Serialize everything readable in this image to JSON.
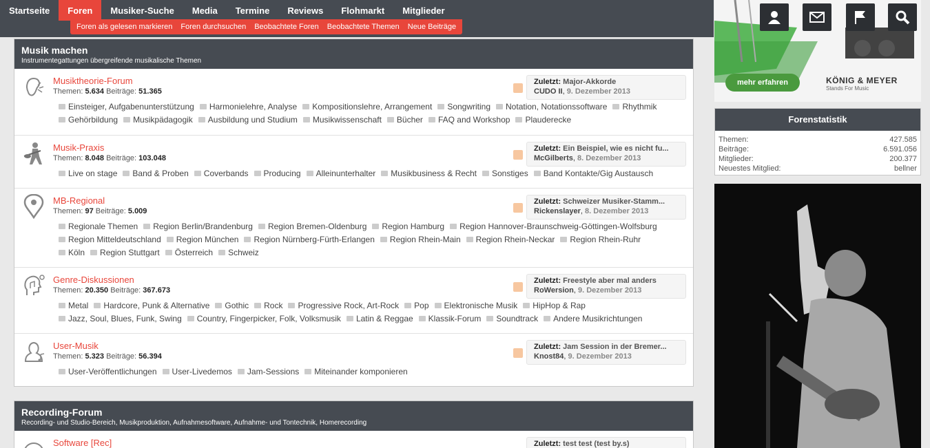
{
  "nav": {
    "items": [
      "Startseite",
      "Foren",
      "Musiker-Suche",
      "Media",
      "Termine",
      "Reviews",
      "Flohmarkt",
      "Mitglieder"
    ],
    "sub": [
      "Foren als gelesen markieren",
      "Foren durchsuchen",
      "Beobachtete Foren",
      "Beobachtete Themen",
      "Neue Beiträge"
    ]
  },
  "toolbar": {
    "icons": [
      "user-icon",
      "mail-icon",
      "flag-icon",
      "search-icon"
    ]
  },
  "sections": [
    {
      "title": "Musik machen",
      "subtitle": "Instrumentegattungen übergreifende musikalische Themen",
      "nodes": [
        {
          "title": "Musiktheorie-Forum",
          "themen_label": "Themen:",
          "themen": "5.634",
          "beitraege_label": "Beiträge:",
          "beitraege": "51.365",
          "subforums": [
            "Einsteiger, Aufgabenunterstützung",
            "Harmonielehre, Analyse",
            "Kompositionslehre, Arrangement",
            "Songwriting",
            "Notation, Notationssoftware",
            "Rhythmik",
            "Gehörbildung",
            "Musikpädagogik",
            "Ausbildung und Studium",
            "Musikwissenschaft",
            "Bücher",
            "FAQ and Workshop",
            "Plauderecke"
          ],
          "last_label": "Zuletzt:",
          "last_title": "Major-Akkorde",
          "last_user": "CUDO II",
          "last_date": "9. Dezember 2013"
        },
        {
          "title": "Musik-Praxis",
          "themen_label": "Themen:",
          "themen": "8.048",
          "beitraege_label": "Beiträge:",
          "beitraege": "103.048",
          "subforums": [
            "Live on stage",
            "Band & Proben",
            "Coverbands",
            "Producing",
            "Alleinunterhalter",
            "Musikbusiness & Recht",
            "Sonstiges",
            "Band Kontakte/Gig Austausch"
          ],
          "last_label": "Zuletzt:",
          "last_title": "Ein Beispiel, wie es nicht fu...",
          "last_user": "McGilberts",
          "last_date": "8. Dezember 2013"
        },
        {
          "title": "MB-Regional",
          "themen_label": "Themen:",
          "themen": "97",
          "beitraege_label": "Beiträge:",
          "beitraege": "5.009",
          "subforums": [
            "Regionale Themen",
            "Region Berlin/Brandenburg",
            "Region Bremen-Oldenburg",
            "Region Hamburg",
            "Region Hannover-Braunschweig-Göttingen-Wolfsburg",
            "Region Mitteldeutschland",
            "Region München",
            "Region Nürnberg-Fürth-Erlangen",
            "Region Rhein-Main",
            "Region Rhein-Neckar",
            "Region Rhein-Ruhr",
            "Köln",
            "Region Stuttgart",
            "Österreich",
            "Schweiz"
          ],
          "last_label": "Zuletzt:",
          "last_title": "Schweizer Musiker-Stamm...",
          "last_user": "Rickenslayer",
          "last_date": "8. Dezember 2013"
        },
        {
          "title": "Genre-Diskussionen",
          "themen_label": "Themen:",
          "themen": "20.350",
          "beitraege_label": "Beiträge:",
          "beitraege": "367.673",
          "subforums": [
            "Metal",
            "Hardcore, Punk & Alternative",
            "Gothic",
            "Rock",
            "Progressive Rock, Art-Rock",
            "Pop",
            "Elektronische Musik",
            "HipHop & Rap",
            "Jazz, Soul, Blues, Funk, Swing",
            "Country, Fingerpicker, Folk, Volksmusik",
            "Latin & Reggae",
            "Klassik-Forum",
            "Soundtrack",
            "Andere Musikrichtungen"
          ],
          "last_label": "Zuletzt:",
          "last_title": "Freestyle aber mal anders",
          "last_user": "RoWersion",
          "last_date": "9. Dezember 2013"
        },
        {
          "title": "User-Musik",
          "themen_label": "Themen:",
          "themen": "5.323",
          "beitraege_label": "Beiträge:",
          "beitraege": "56.394",
          "subforums": [
            "User-Veröffentlichungen",
            "User-Livedemos",
            "Jam-Sessions",
            "Miteinander komponieren"
          ],
          "last_label": "Zuletzt:",
          "last_title": "Jam Session in der Bremer...",
          "last_user": "Knost84",
          "last_date": "9. Dezember 2013"
        }
      ]
    },
    {
      "title": "Recording-Forum",
      "subtitle": "Recording- und Studio-Bereich, Musikproduktion, Aufnahmesoftware, Aufnahme- und Tontechnik, Homerecording",
      "nodes": [
        {
          "title": "Software [Rec]",
          "last_label": "Zuletzt:",
          "last_title": "test test (test by.s)"
        }
      ]
    }
  ],
  "ad": {
    "button": "mehr erfahren",
    "brand": "KÖNIG & MEYER",
    "tagline": "Stands For Music"
  },
  "stats": {
    "title": "Forenstatistik",
    "rows": [
      {
        "label": "Themen:",
        "value": "427.585"
      },
      {
        "label": "Beiträge:",
        "value": "6.591.056"
      },
      {
        "label": "Mitglieder:",
        "value": "200.377"
      },
      {
        "label": "Neuestes Mitglied:",
        "value": "bellner"
      }
    ]
  }
}
